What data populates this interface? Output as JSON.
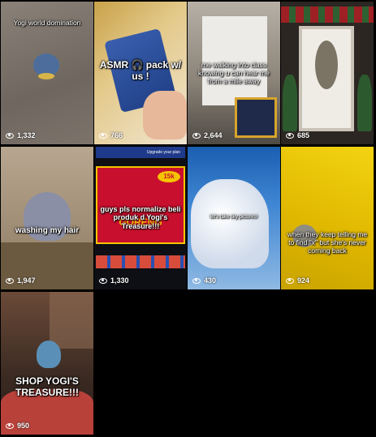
{
  "videos": [
    {
      "caption": "Yogi world domination",
      "views": "1,332"
    },
    {
      "caption": "ASMR 🎧 pack w/ us !",
      "views": "766"
    },
    {
      "caption": "me walking into class knowing u can hear me from a mile away",
      "views": "2,644"
    },
    {
      "caption": "",
      "views": "685"
    },
    {
      "caption": "washing my hair",
      "views": "1,947"
    },
    {
      "caption": "guys pls normalize beli produk d Yogi's Treasure!!!",
      "views": "1,330",
      "inner_title": "GORENG",
      "inner_badge": "15k",
      "inner_header": "Upgrade your plan"
    },
    {
      "caption": "let's take sky pictures!",
      "views": "430"
    },
    {
      "caption": "when they keep telling me to find \"x\" but she's never coming back",
      "views": "924"
    },
    {
      "caption": "SHOP YOGI'S TREASURE!!!",
      "views": "950"
    }
  ]
}
